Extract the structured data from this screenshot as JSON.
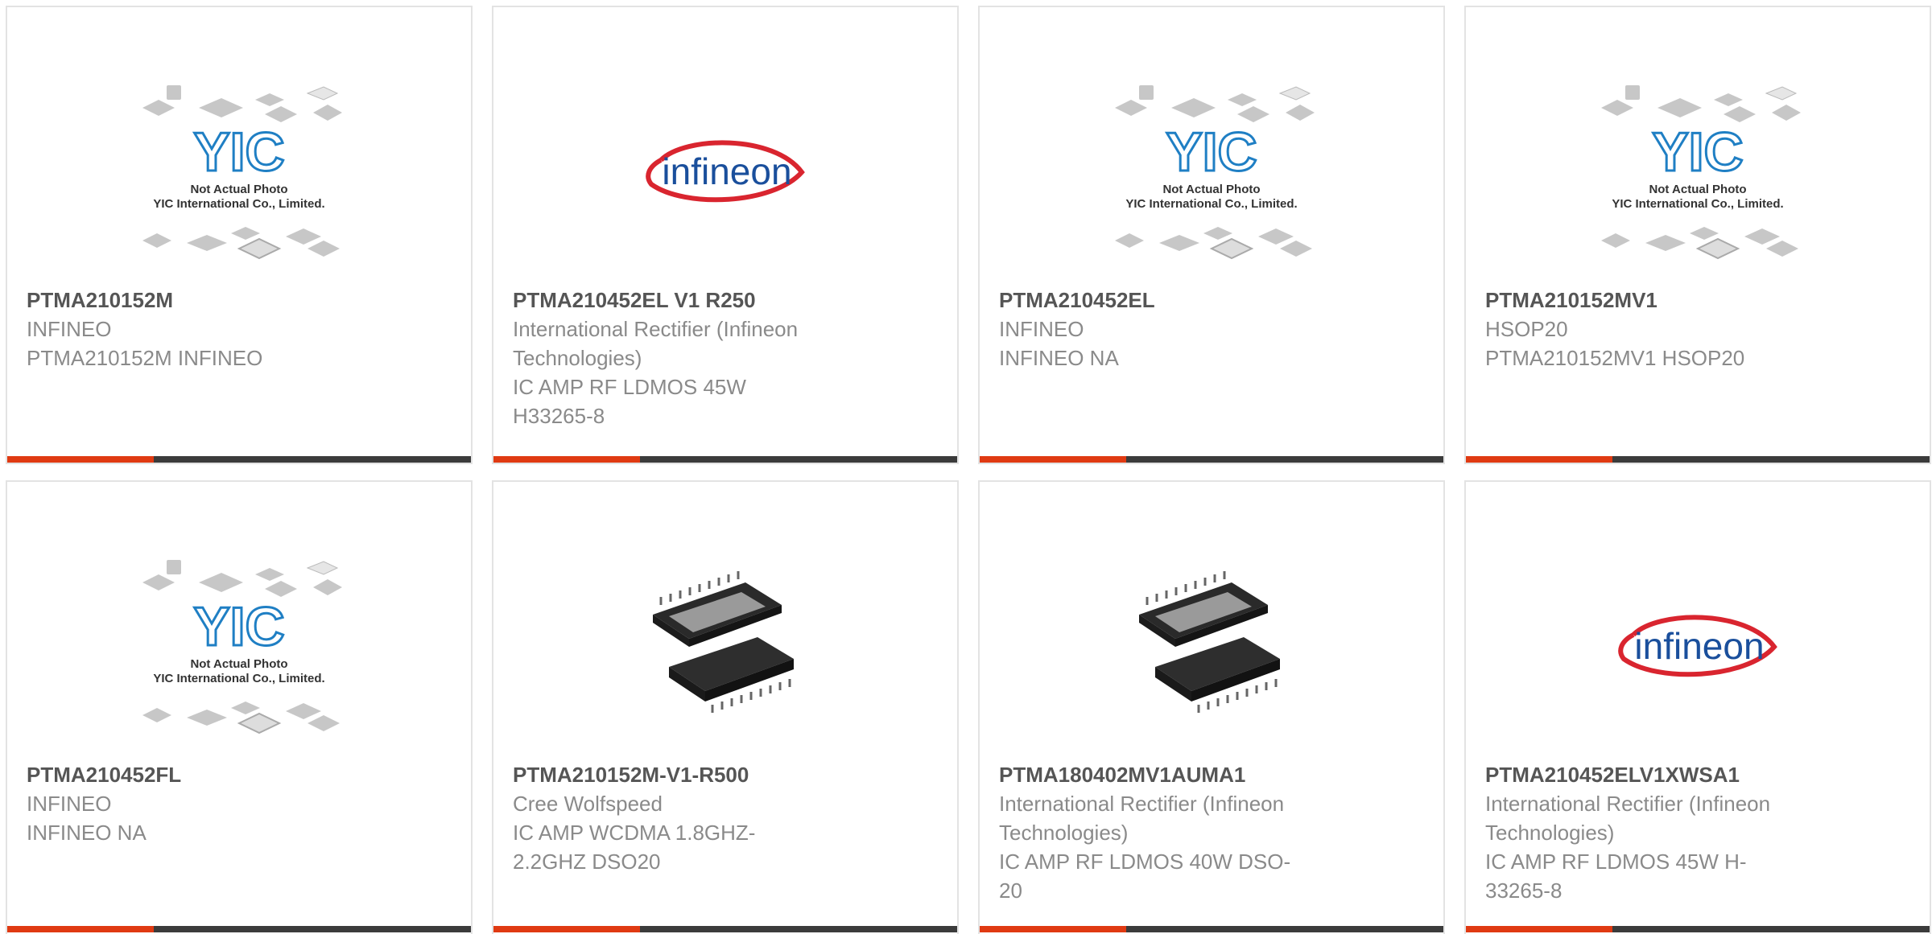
{
  "products": [
    {
      "image": "yic-placeholder",
      "part_number": "PTMA210152M",
      "lines": [
        "INFINEO",
        "PTMA210152M INFINEO"
      ]
    },
    {
      "image": "infineon-logo",
      "part_number": "PTMA210452EL V1 R250",
      "lines": [
        "International Rectifier (Infineon",
        "Technologies)",
        "IC AMP RF LDMOS 45W",
        "H33265-8"
      ]
    },
    {
      "image": "yic-placeholder",
      "part_number": "PTMA210452EL",
      "lines": [
        "INFINEO",
        "INFINEO NA"
      ]
    },
    {
      "image": "yic-placeholder",
      "part_number": "PTMA210152MV1",
      "lines": [
        "HSOP20",
        "PTMA210152MV1 HSOP20"
      ]
    },
    {
      "image": "yic-placeholder",
      "part_number": "PTMA210452FL",
      "lines": [
        "INFINEO",
        "INFINEO NA"
      ]
    },
    {
      "image": "chip-photo",
      "part_number": "PTMA210152M-V1-R500",
      "lines": [
        "Cree Wolfspeed",
        "IC AMP WCDMA 1.8GHZ-",
        "2.2GHZ DSO20"
      ]
    },
    {
      "image": "chip-photo",
      "part_number": "PTMA180402MV1AUMA1",
      "lines": [
        "International Rectifier (Infineon",
        "Technologies)",
        "IC AMP RF LDMOS 40W DSO-",
        "20"
      ]
    },
    {
      "image": "infineon-logo",
      "part_number": "PTMA210452ELV1XWSA1",
      "lines": [
        "International Rectifier (Infineon",
        "Technologies)",
        "IC AMP RF LDMOS 45W H-",
        "33265-8"
      ]
    }
  ],
  "placeholder": {
    "logo_text": "YIC",
    "caption_1": "Not Actual Photo",
    "caption_2": "YIC International Co., Limited."
  },
  "brand_logo_text": "infineon",
  "colors": {
    "accent": "#e03a12",
    "bar": "#3b3b3b",
    "border": "#e3e3e3",
    "part_number": "#555555",
    "text": "#8a8a8a",
    "yic_blue": "#1f7fc4",
    "infineon_blue": "#1a4f9c",
    "infineon_red": "#d9252f"
  }
}
